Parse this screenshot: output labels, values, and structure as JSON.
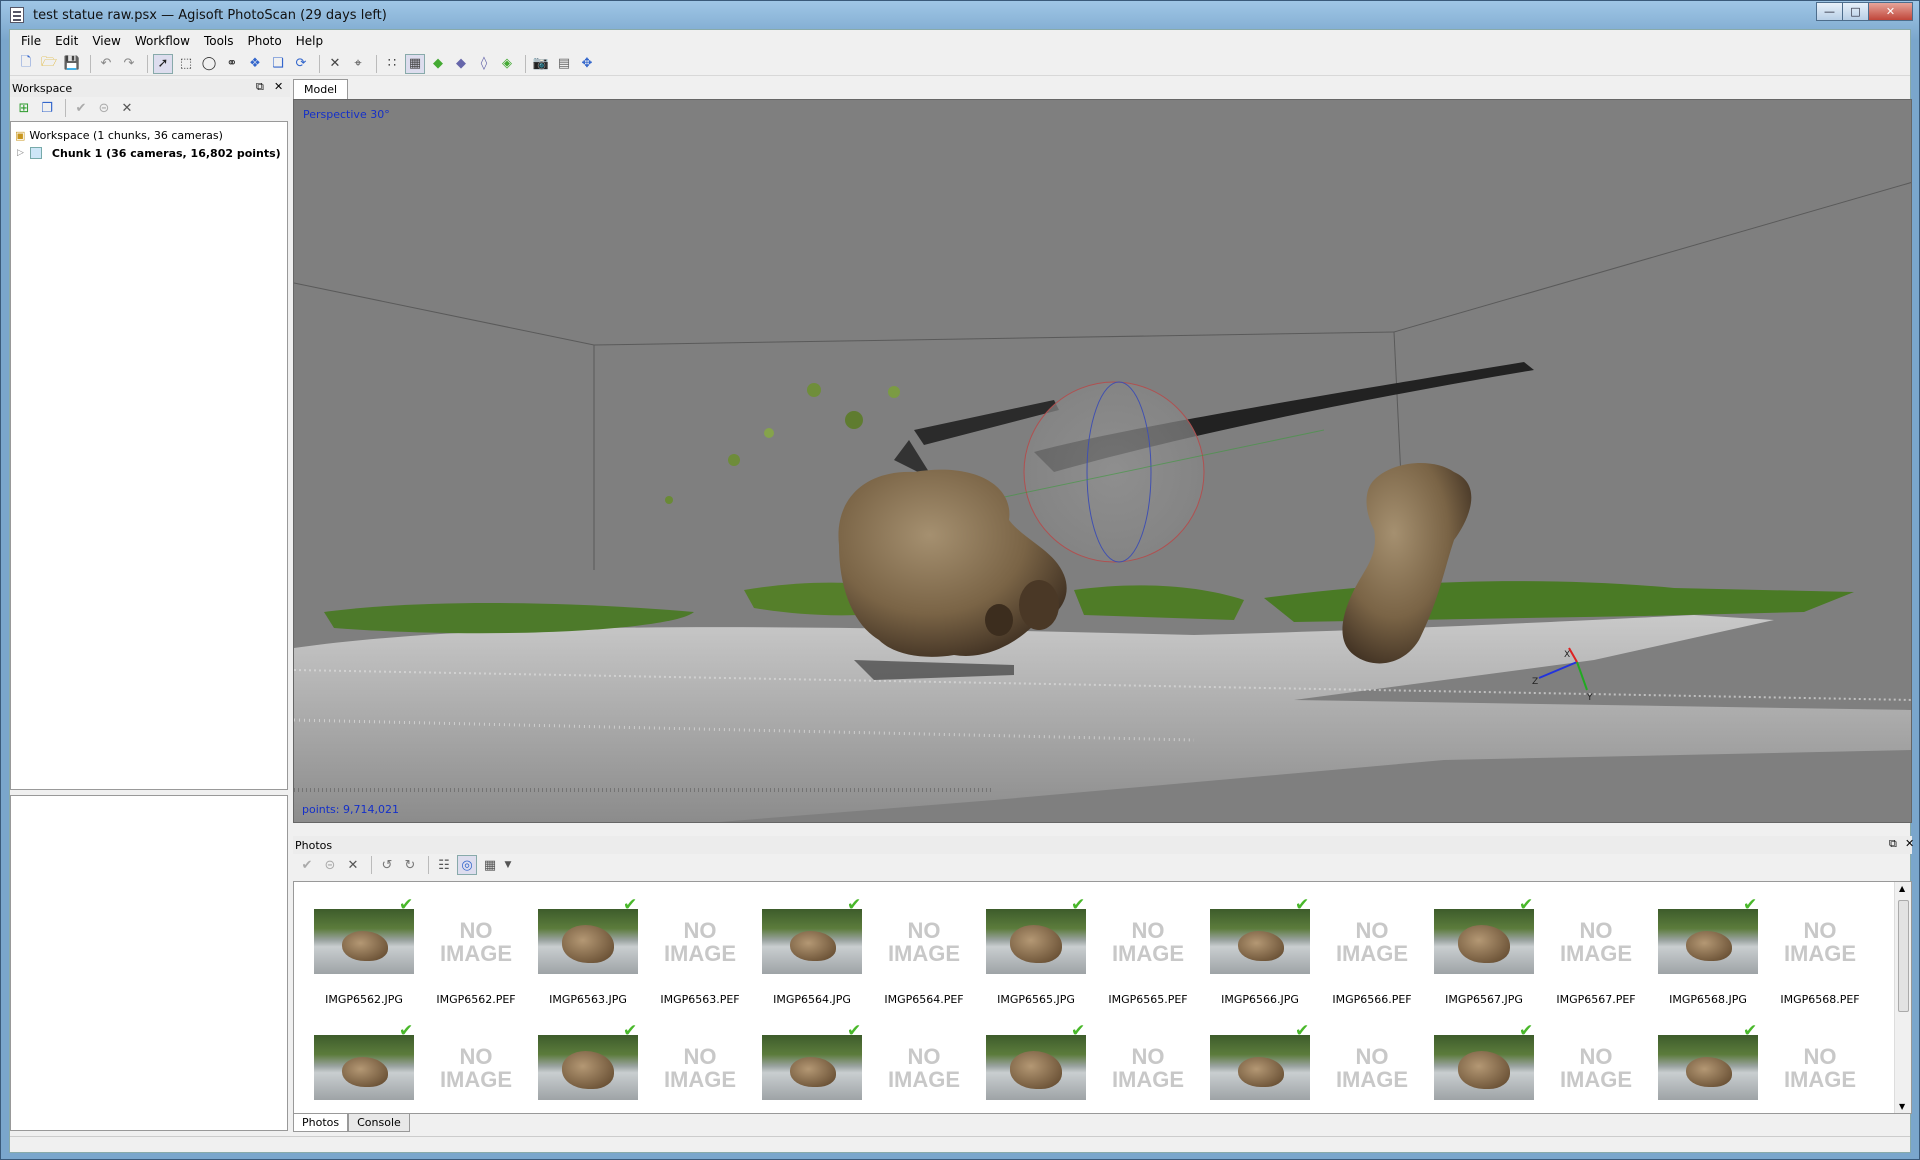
{
  "window": {
    "title": "test statue raw.psx — Agisoft PhotoScan (29 days left)"
  },
  "menu": [
    "File",
    "Edit",
    "View",
    "Workflow",
    "Tools",
    "Photo",
    "Help"
  ],
  "workspace": {
    "title": "Workspace",
    "tree": {
      "root": "Workspace (1 chunks, 36 cameras)",
      "chunk": "Chunk 1 (36 cameras, 16,802 points)"
    }
  },
  "model": {
    "tab": "Model",
    "projection_label": "Perspective 30°",
    "points_label": "points: 9,714,021",
    "axes": [
      "X",
      "Y",
      "Z"
    ]
  },
  "photos": {
    "title": "Photos",
    "row1": [
      {
        "name": "IMGP6562.JPG",
        "has_image": true,
        "checked": true
      },
      {
        "name": "IMGP6562.PEF",
        "has_image": false,
        "checked": false
      },
      {
        "name": "IMGP6563.JPG",
        "has_image": true,
        "checked": true
      },
      {
        "name": "IMGP6563.PEF",
        "has_image": false,
        "checked": false
      },
      {
        "name": "IMGP6564.JPG",
        "has_image": true,
        "checked": true
      },
      {
        "name": "IMGP6564.PEF",
        "has_image": false,
        "checked": false
      },
      {
        "name": "IMGP6565.JPG",
        "has_image": true,
        "checked": true
      },
      {
        "name": "IMGP6565.PEF",
        "has_image": false,
        "checked": false
      },
      {
        "name": "IMGP6566.JPG",
        "has_image": true,
        "checked": true
      },
      {
        "name": "IMGP6566.PEF",
        "has_image": false,
        "checked": false
      },
      {
        "name": "IMGP6567.JPG",
        "has_image": true,
        "checked": true
      },
      {
        "name": "IMGP6567.PEF",
        "has_image": false,
        "checked": false
      },
      {
        "name": "IMGP6568.JPG",
        "has_image": true,
        "checked": true
      },
      {
        "name": "IMGP6568.PEF",
        "has_image": false,
        "checked": false
      }
    ],
    "row2": [
      {
        "has_image": true,
        "checked": true
      },
      {
        "has_image": false,
        "checked": false
      },
      {
        "has_image": true,
        "checked": true
      },
      {
        "has_image": false,
        "checked": false
      },
      {
        "has_image": true,
        "checked": true
      },
      {
        "has_image": false,
        "checked": false
      },
      {
        "has_image": true,
        "checked": true
      },
      {
        "has_image": false,
        "checked": false
      },
      {
        "has_image": true,
        "checked": true
      },
      {
        "has_image": false,
        "checked": false
      },
      {
        "has_image": true,
        "checked": true
      },
      {
        "has_image": false,
        "checked": false
      },
      {
        "has_image": true,
        "checked": true
      },
      {
        "has_image": false,
        "checked": false
      }
    ],
    "no_image_label": "NO IMAGE",
    "tabs": [
      "Photos",
      "Console"
    ]
  },
  "colors": {
    "viewport_bg": "#7f7f7f",
    "label_blue": "#1530c8",
    "check_green": "#49b82a"
  }
}
